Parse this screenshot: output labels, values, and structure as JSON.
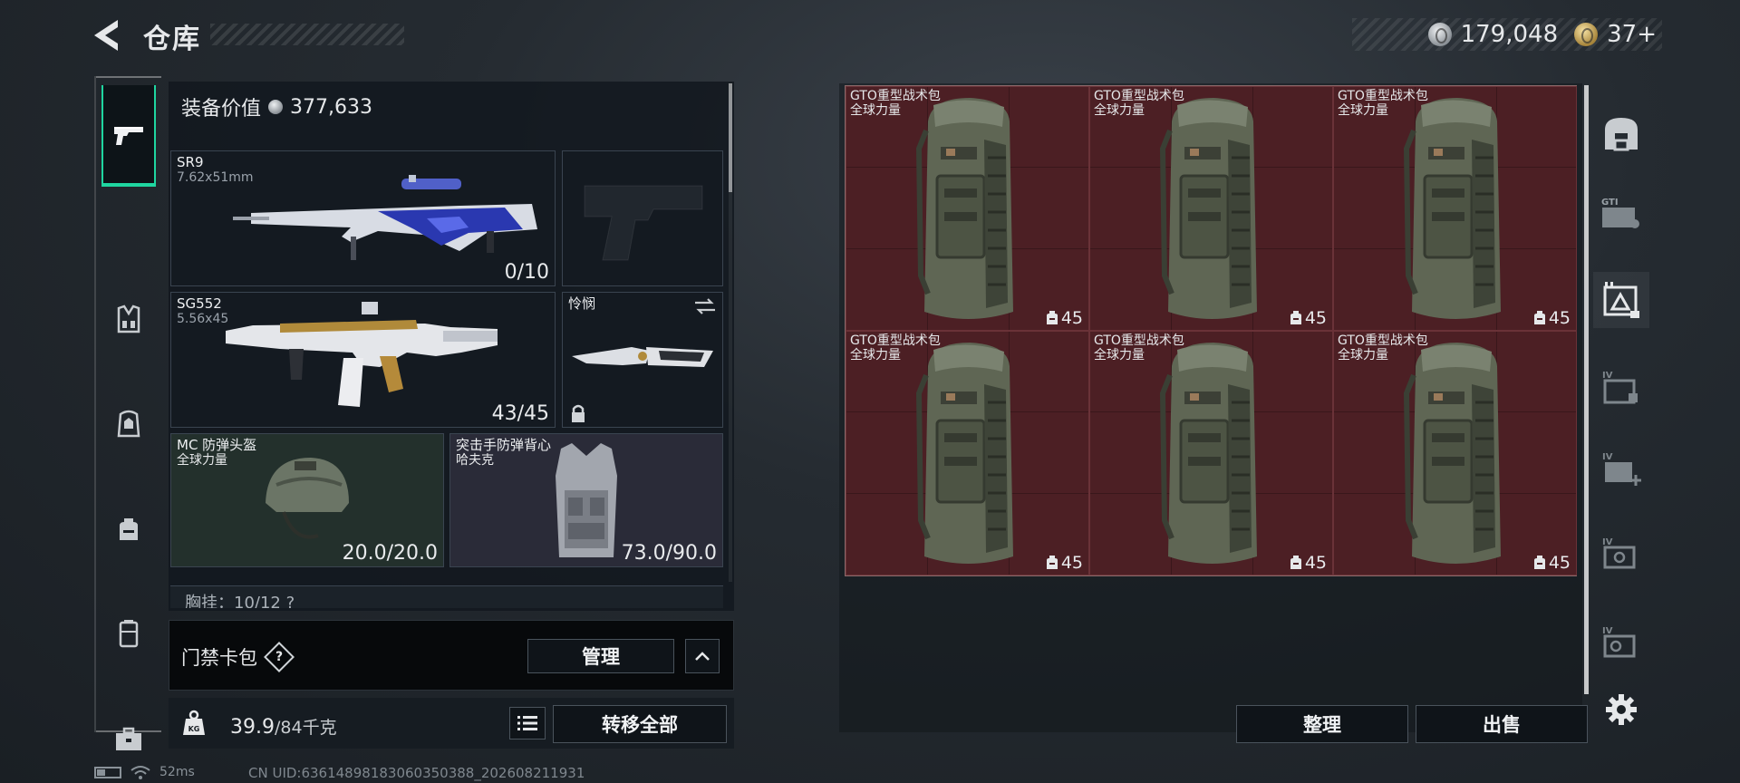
{
  "header": {
    "title": "仓库",
    "currency_silver": "179,048",
    "currency_gold": "37+"
  },
  "left_tabs": [
    {
      "name": "weapon",
      "icon": "pistol-icon",
      "active": true
    },
    {
      "name": "armor",
      "icon": "vest-icon",
      "active": false
    },
    {
      "name": "rig",
      "icon": "rig-icon",
      "active": false
    },
    {
      "name": "backpack",
      "icon": "backpack-icon",
      "active": false
    },
    {
      "name": "container",
      "icon": "canister-icon",
      "active": false
    },
    {
      "name": "case",
      "icon": "toolbox-icon",
      "active": false
    }
  ],
  "equipment": {
    "value_label": "装备价值",
    "value": "377,633",
    "primary": {
      "name": "SR9",
      "caliber": "7.62x51mm",
      "ammo": "0/10"
    },
    "secondary": {
      "name": "SG552",
      "caliber": "5.56x45",
      "ammo": "43/45"
    },
    "pistol_slot": {
      "empty": true
    },
    "melee": {
      "name": "怜悯"
    },
    "helmet": {
      "name": "MC 防弹头盔",
      "faction": "全球力量",
      "durability": "20.0/20.0"
    },
    "vest": {
      "name": "突击手防弹背心",
      "faction": "哈夫克",
      "durability": "73.0/90.0"
    },
    "pouch_row": "胸挂：10/12  ?"
  },
  "keycard": {
    "label": "门禁卡包",
    "help": "?",
    "manage_label": "管理"
  },
  "footer_left": {
    "weight_current": "39.9",
    "weight_max": "/84千克",
    "transfer_label": "转移全部",
    "ping": "52ms",
    "uid": "CN UID:636148981830603503​88_202608211931"
  },
  "storage": {
    "items": [
      {
        "name": "GTO重型战术包",
        "faction": "全球力量",
        "capacity": "45"
      },
      {
        "name": "GTO重型战术包",
        "faction": "全球力量",
        "capacity": "45"
      },
      {
        "name": "GTO重型战术包",
        "faction": "全球力量",
        "capacity": "45"
      },
      {
        "name": "GTO重型战术包",
        "faction": "全球力量",
        "capacity": "45"
      },
      {
        "name": "GTO重型战术包",
        "faction": "全球力量",
        "capacity": "45"
      },
      {
        "name": "GTO重型战术包",
        "faction": "全球力量",
        "capacity": "45"
      }
    ],
    "sort_label": "整理",
    "sell_label": "出售"
  },
  "right_tabs": {
    "labels": [
      "GTI",
      "IV",
      "IV",
      "IV",
      "IV"
    ]
  },
  "colors": {
    "accent": "#1fd6a0",
    "storage_cell": "#4c1f24",
    "helmet_bg": "#23302c",
    "vest_bg": "#2a2b38"
  }
}
